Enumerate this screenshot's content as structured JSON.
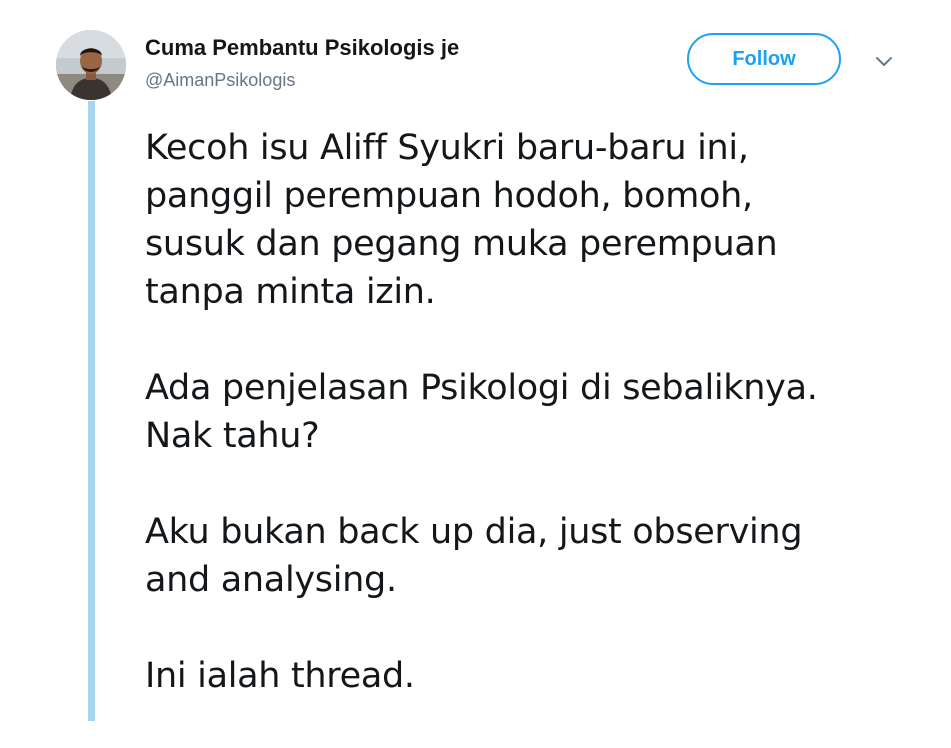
{
  "user": {
    "display_name": "Cuma Pembantu Psikologis je",
    "handle": "@AimanPsikologis"
  },
  "actions": {
    "follow_label": "Follow"
  },
  "tweet": {
    "paragraphs": [
      [
        "Kecoh isu Aliff Syukri baru-baru ini,",
        "panggil perempuan hodoh, bomoh,",
        "susuk dan pegang muka perempuan",
        "tanpa minta izin."
      ],
      [
        "Ada penjelasan Psikologi di sebaliknya.",
        "Nak tahu?"
      ],
      [
        "Aku bukan back up dia, just observing",
        "and analysing."
      ],
      [
        "Ini ialah thread."
      ]
    ]
  },
  "colors": {
    "accent": "#1da1f2",
    "thread_line": "#a8d4ec",
    "secondary_text": "#657786",
    "primary_text": "#14171a"
  }
}
